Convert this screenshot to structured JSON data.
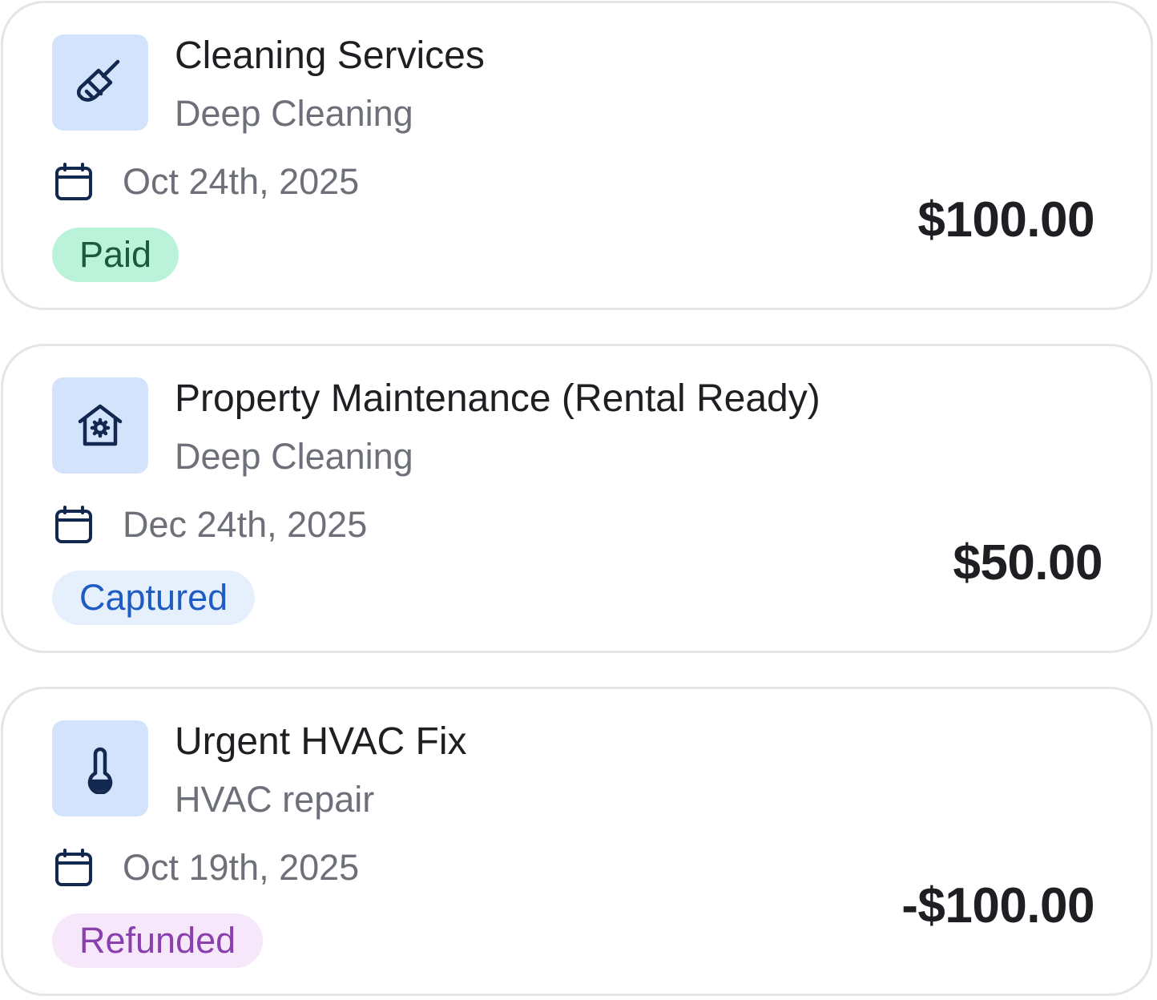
{
  "transactions": [
    {
      "icon": "broom-icon",
      "title": "Cleaning Services",
      "subtitle": "Deep Cleaning",
      "date": "Oct 24th, 2025",
      "status": "Paid",
      "amount": "$100.00"
    },
    {
      "icon": "house-gear-icon",
      "title": "Property Maintenance (Rental Ready)",
      "subtitle": "Deep Cleaning",
      "date": "Dec 24th, 2025",
      "status": "Captured",
      "amount": "$50.00"
    },
    {
      "icon": "thermometer-icon",
      "title": "Urgent HVAC Fix",
      "subtitle": "HVAC repair",
      "date": "Oct 19th, 2025",
      "status": "Refunded",
      "amount": "-$100.00"
    }
  ],
  "colors": {
    "icon_tile_bg": "#d3e3fb",
    "icon_stroke": "#13284f",
    "paid_bg": "#bbf2da",
    "paid_text": "#1a5c3a",
    "captured_bg": "#e6effc",
    "captured_text": "#1e5bc2",
    "refunded_bg": "#f6e8fa",
    "refunded_text": "#8a3fae",
    "card_border": "#e4e5e8"
  }
}
